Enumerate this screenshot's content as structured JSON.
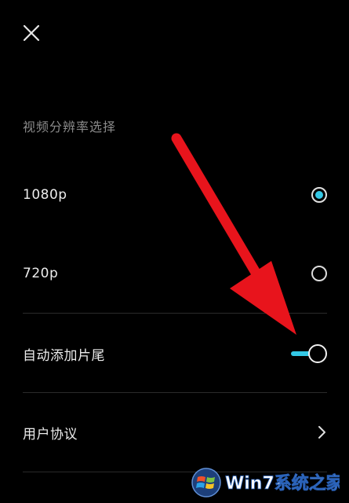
{
  "header": {
    "close_icon": "close-icon"
  },
  "resolution": {
    "section_title": "视频分辨率选择",
    "options": [
      {
        "label": "1080p",
        "selected": true
      },
      {
        "label": "720p",
        "selected": false
      }
    ]
  },
  "auto_ending": {
    "label": "自动添加片尾",
    "enabled": true
  },
  "user_agreement": {
    "label": "用户协议",
    "icon": "chevron-right-icon"
  },
  "watermark": {
    "text": "Win7系统之家"
  },
  "colors": {
    "background": "#000000",
    "accent": "#33c8e6",
    "annotation_arrow": "#e8141c",
    "secondary_text": "#8a8a8a"
  }
}
